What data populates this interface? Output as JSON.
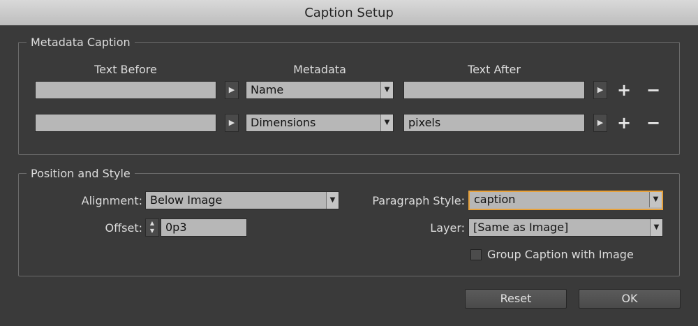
{
  "window": {
    "title": "Caption Setup"
  },
  "metadata_caption": {
    "legend": "Metadata Caption",
    "headers": {
      "text_before": "Text Before",
      "metadata": "Metadata",
      "text_after": "Text After"
    },
    "rows": [
      {
        "text_before": "",
        "metadata": "Name",
        "text_after": ""
      },
      {
        "text_before": "",
        "metadata": "Dimensions",
        "text_after": "pixels"
      }
    ],
    "add_symbol": "+",
    "remove_symbol": "−",
    "arrow_symbol": "▶",
    "caret_symbol": "▼"
  },
  "position_style": {
    "legend": "Position and Style",
    "alignment_label": "Alignment:",
    "alignment_value": "Below Image",
    "offset_label": "Offset:",
    "offset_value": "0p3",
    "paragraph_style_label": "Paragraph Style:",
    "paragraph_style_value": "caption",
    "layer_label": "Layer:",
    "layer_value": "[Same as Image]",
    "group_caption_label": "Group Caption with Image",
    "group_caption_checked": false
  },
  "buttons": {
    "reset": "Reset",
    "ok": "OK"
  }
}
